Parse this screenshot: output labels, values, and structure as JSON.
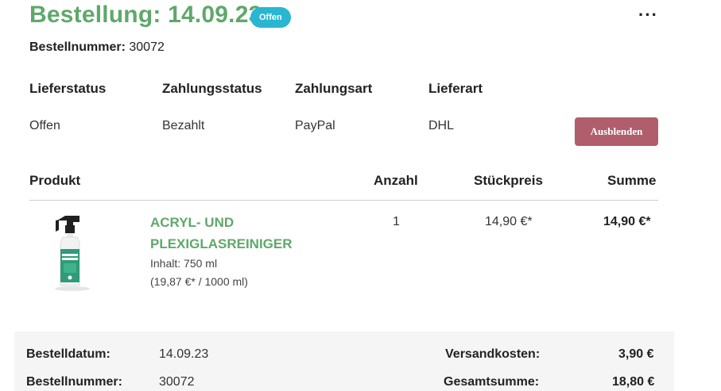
{
  "header": {
    "title": "Bestellung: 14.09.23",
    "status_badge": "Offen",
    "menu_icon": "more-horizontal-icon",
    "order_number_label": "Bestellnummer:",
    "order_number": "30072"
  },
  "info": {
    "labels": [
      "Lieferstatus",
      "Zahlungsstatus",
      "Zahlungsart",
      "Lieferart"
    ],
    "values": [
      "Offen",
      "Bezahlt",
      "PayPal",
      "DHL"
    ],
    "hide_button": "Ausblenden"
  },
  "table": {
    "headers": [
      "Produkt",
      "Anzahl",
      "Stückpreis",
      "Summe"
    ],
    "items": [
      {
        "name": "Acryl- und Plexiglasreiniger",
        "content": "Inhalt: 750 ml",
        "base_price": "(19,87 €* / 1000 ml)",
        "quantity": "1",
        "unit_price": "14,90 €*",
        "total": "14,90 €*",
        "image_icon": "spray-bottle-icon"
      }
    ]
  },
  "summary": {
    "date_label": "Bestelldatum:",
    "date": "14.09.23",
    "number_label": "Bestellnummer:",
    "number": "30072",
    "shipping_label": "Versandkosten:",
    "shipping": "3,90 €",
    "total_label": "Gesamtsumme:",
    "total": "18,80 €"
  },
  "colors": {
    "accent_green": "#5fa86a",
    "badge_blue": "#29b6d1",
    "button_red": "#b05d6c"
  }
}
